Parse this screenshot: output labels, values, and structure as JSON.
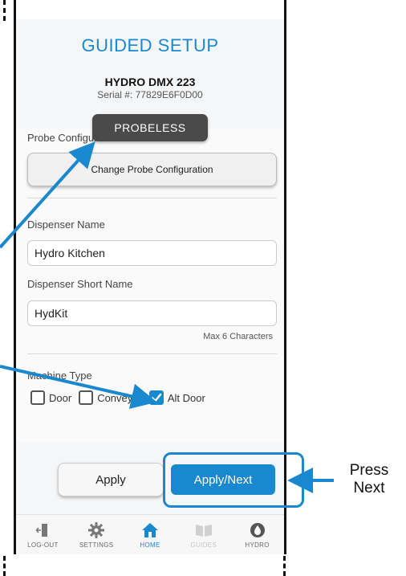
{
  "header": {
    "title": "GUIDED SETUP",
    "device_name": "HYDRO DMX 223",
    "serial": "Serial #: 77829E6F0D00"
  },
  "probe": {
    "label": "Probe Configur",
    "badge": "PROBELESS",
    "change_button": "Change Probe Configuration"
  },
  "dispenser": {
    "name_label": "Dispenser Name",
    "name_value": "Hydro Kitchen",
    "short_label": "Dispenser Short Name",
    "short_value": "HydKit",
    "short_hint": "Max 6 Characters"
  },
  "machine": {
    "label": "Machine Type",
    "options": [
      {
        "label": "Door",
        "checked": false
      },
      {
        "label": "Conveyor",
        "checked": false
      },
      {
        "label": "Alt Door",
        "checked": true
      }
    ]
  },
  "actions": {
    "apply": "Apply",
    "apply_next": "Apply/Next"
  },
  "tabbar": {
    "items": [
      {
        "label": "LOG-OUT",
        "icon": "logout-icon",
        "state": "normal"
      },
      {
        "label": "SETTINGS",
        "icon": "gear-icon",
        "state": "normal"
      },
      {
        "label": "HOME",
        "icon": "home-icon",
        "state": "active"
      },
      {
        "label": "GUIDES",
        "icon": "book-icon",
        "state": "disabled"
      },
      {
        "label": "HYDRO",
        "icon": "drop-icon",
        "state": "normal"
      }
    ]
  },
  "annotation": {
    "callout_line1": "Press",
    "callout_line2": "Next"
  },
  "colors": {
    "accent": "#1a88cf",
    "badge_bg": "#4a4a4a"
  }
}
